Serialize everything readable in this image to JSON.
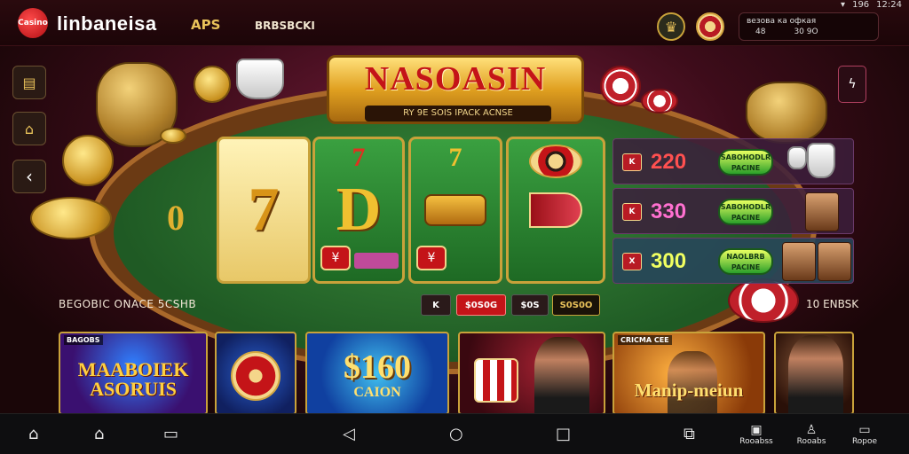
{
  "topbar": {
    "logo_text": "Casino",
    "brand": "linbaneisa",
    "nav_link_1": "APS",
    "nav_link_2": "BRBSBCKI",
    "status_time": "12:24",
    "status_battery": "196",
    "balance_line1": "везова ка офкая",
    "balance_line2_left": "48",
    "balance_line2_right": "30 9O"
  },
  "banner": {
    "title": "NASOASIN",
    "subtitle": "RY 9E SOIS IPACK ACNSE"
  },
  "reels": {
    "zero_label": "0",
    "r1_symbol": "7",
    "r2_top": "7",
    "r2_symbol": "D",
    "r3_top": "7"
  },
  "jackpots": [
    {
      "badge": "K",
      "value": "220",
      "value_color": "#ff5050",
      "button": "SABOHODLR PACINE"
    },
    {
      "badge": "K",
      "value": "330",
      "value_color": "#ff70d0",
      "button": "SABOHODLR PACINE"
    },
    {
      "badge": "X",
      "value": "300",
      "value_color": "#f0ff60",
      "button": "NAOLBRB PACINE"
    }
  ],
  "bet_strip": {
    "left_label": "BEGOBIC ONACE 5CSHB",
    "pill0": "K",
    "pill1": "$0S0G",
    "pill2": "$0S",
    "pill3": "S0S0O",
    "right_label": "10 ENBSK"
  },
  "tiles": [
    {
      "tag": "BAGOBS",
      "title": "MAABOIEK ASORUIS"
    },
    {
      "tag": "",
      "title": ""
    },
    {
      "tag": "",
      "title_big": "$160",
      "title_small": "CAION"
    },
    {
      "tag": "",
      "title": ""
    },
    {
      "tag": "CRICMA CEE",
      "title": "Manip-meiun"
    },
    {
      "tag": "",
      "title": ""
    }
  ],
  "bottomnav": {
    "icons": [
      "home-outline-icon",
      "home-icon",
      "message-icon",
      "back-icon",
      "home-circle-icon",
      "recent-apps-icon",
      "gallery-icon"
    ],
    "labels": [
      "Rooabss",
      "Rooabs",
      "Ropoe"
    ]
  },
  "colors": {
    "accent_gold": "#e9c25a",
    "casino_red": "#c41418",
    "felt_green": "#1f5a24"
  }
}
